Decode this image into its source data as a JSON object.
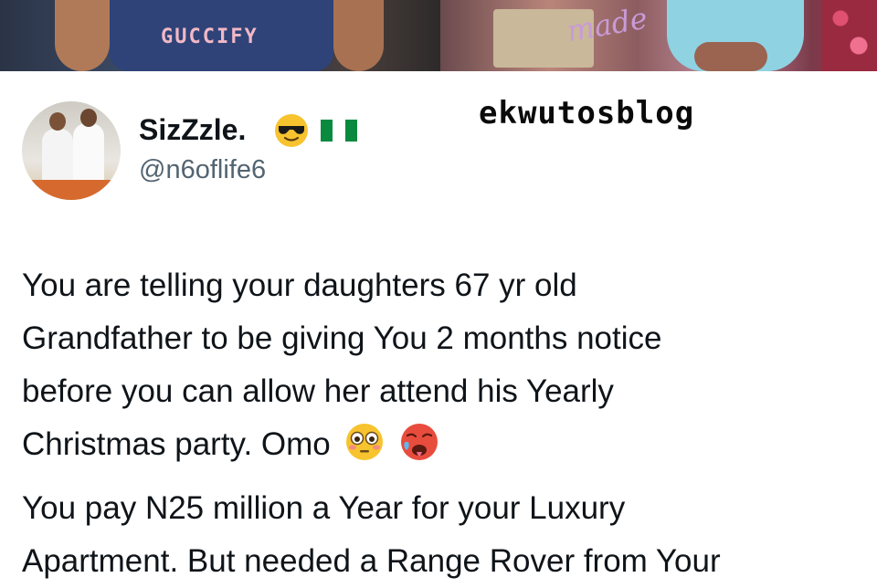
{
  "photos": {
    "left_shirt_text": "GUCCIFY",
    "right_topper_text": "made"
  },
  "profile": {
    "display_name": "SizZzle.",
    "handle": "@n6oflife6",
    "badges": [
      "sunglasses-emoji",
      "nigeria-flag"
    ],
    "flag_colors": [
      "#0a8a3e",
      "#ffffff",
      "#0a8a3e"
    ]
  },
  "watermark": "ekwutosblog",
  "tweet": {
    "lines": [
      "You are telling your daughters 67 yr old",
      "Grandfather to be giving You 2 months notice",
      "before you can allow her attend his Yearly",
      "Christmas party. Omo"
    ],
    "line_emojis": [
      "flushed-face-emoji",
      "hot-face-emoji"
    ],
    "paragraph2_lines": [
      "You pay N25 million a Year for your Luxury",
      "Apartment. But needed a Range Rover from Your"
    ]
  },
  "colors": {
    "text": "#0f1419",
    "handle": "#536471"
  }
}
